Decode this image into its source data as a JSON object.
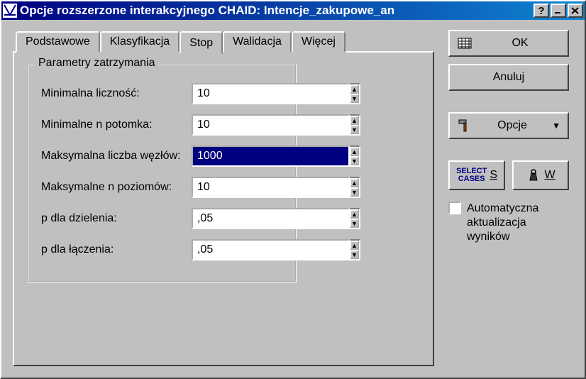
{
  "window": {
    "title": "Opcje rozszerzone interakcyjnego CHAID: Intencje_zakupowe_an"
  },
  "tabs": [
    {
      "label": "Podstawowe"
    },
    {
      "label": "Klasyfikacja"
    },
    {
      "label": "Stop"
    },
    {
      "label": "Walidacja"
    },
    {
      "label": "Więcej"
    }
  ],
  "group": {
    "legend": "Parametry zatrzymania",
    "rows": [
      {
        "label": "Minimalna liczność:",
        "value": "10",
        "selected": false
      },
      {
        "label": "Minimalne n potomka:",
        "value": "10",
        "selected": false
      },
      {
        "label": "Maksymalna liczba węzłów:",
        "value": "1000",
        "selected": true
      },
      {
        "label": "Maksymalne n poziomów:",
        "value": "10",
        "selected": false
      },
      {
        "label": "p dla dzielenia:",
        "value": ",05",
        "selected": false
      },
      {
        "label": "p dla łączenia:",
        "value": ",05",
        "selected": false
      }
    ]
  },
  "right": {
    "ok": "OK",
    "cancel": "Anuluj",
    "options": "Opcje",
    "select_cases_line1": "SELECT",
    "select_cases_line2": "CASES",
    "select_cases_hotkey": "S",
    "weight_hotkey": "W",
    "auto_update": "Automatyczna aktualizacja wyników"
  }
}
